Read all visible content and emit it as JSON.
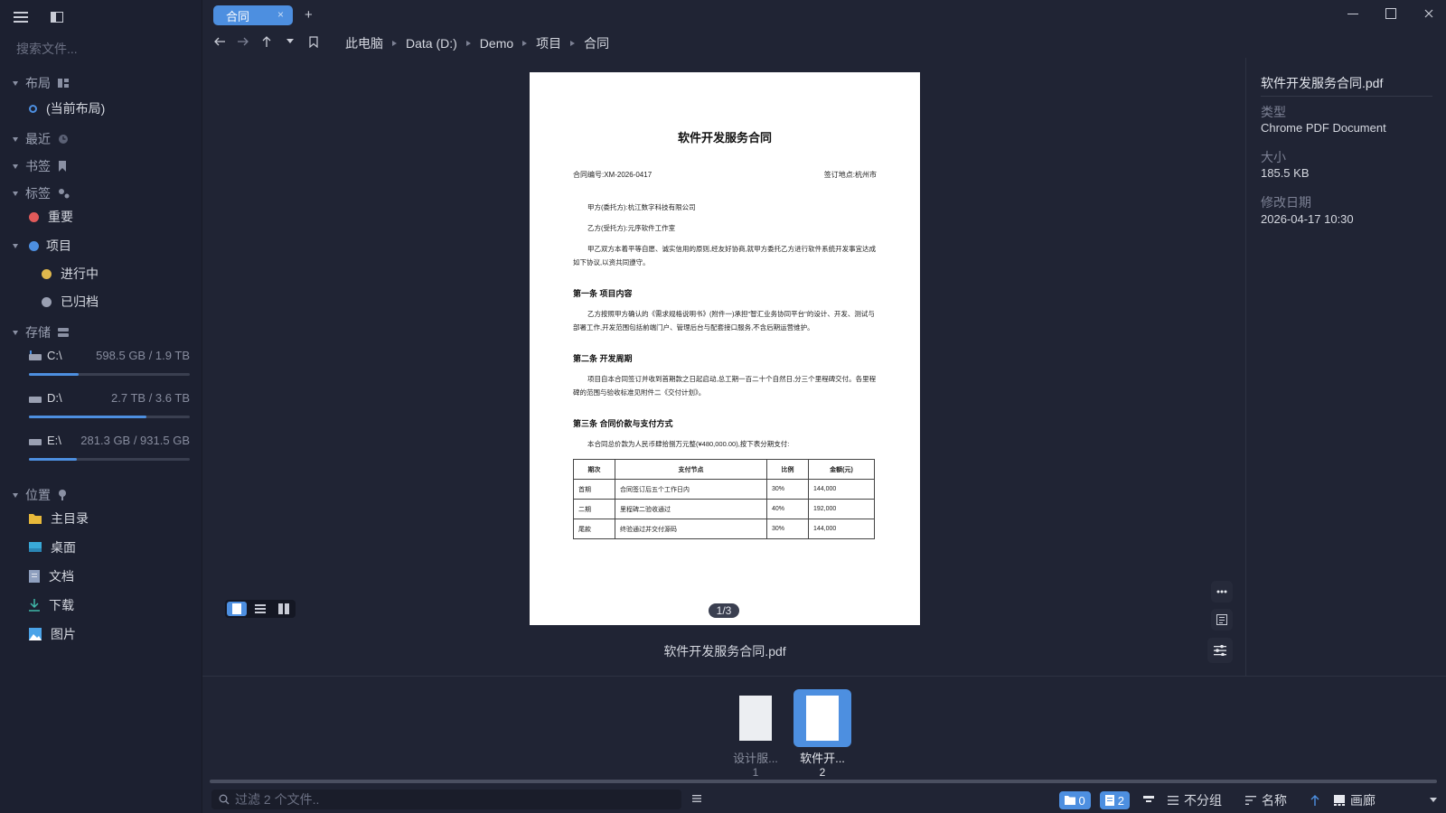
{
  "sidebar": {
    "search_placeholder": "搜索文件...",
    "sections": {
      "layout": "布局",
      "recent": "最近",
      "bookmarks": "书签",
      "tags": "标签",
      "storage": "存储",
      "locations": "位置"
    },
    "layout_current": "(当前布局)",
    "tags": [
      {
        "label": "重要",
        "color": "#e05a5a"
      },
      {
        "label": "项目",
        "color": "#4d8fe0"
      },
      {
        "label": "进行中",
        "color": "#e0b84d"
      },
      {
        "label": "已归档",
        "color": "#9aa0b2"
      }
    ],
    "drives": [
      {
        "name": "C:\\",
        "capacity": "598.5 GB / 1.9 TB",
        "used_fraction": 0.31
      },
      {
        "name": "D:\\",
        "capacity": "2.7 TB / 3.6 TB",
        "used_fraction": 0.73
      },
      {
        "name": "E:\\",
        "capacity": "281.3 GB / 931.5 GB",
        "used_fraction": 0.3
      }
    ],
    "locations": [
      {
        "label": "主目录",
        "icon": "folder-icon"
      },
      {
        "label": "桌面",
        "icon": "desktop-icon"
      },
      {
        "label": "文档",
        "icon": "document-icon"
      },
      {
        "label": "下载",
        "icon": "download-icon"
      },
      {
        "label": "图片",
        "icon": "image-icon"
      }
    ]
  },
  "tabs": [
    {
      "label": "合同",
      "close": "×"
    }
  ],
  "new_tab": "+",
  "breadcrumb": [
    "此电脑",
    "Data (D:)",
    "Demo",
    "项目",
    "合同"
  ],
  "document": {
    "title": "软件开发服务合同",
    "contract_no": "合同编号:XM-2026-0417",
    "place": "签订地点:杭州市",
    "party_a": "甲方(委托方):杭江数字科技有限公司",
    "party_b": "乙方(受托方):元序软件工作室",
    "intro": "甲乙双方本着平等自愿、诚实信用的原则,经友好协商,就甲方委托乙方进行软件系统开发事宜达成如下协议,以资共同遵守。",
    "s1_title": "第一条 项目内容",
    "s1_body": "乙方按照甲方确认的《需求规格说明书》(附件一)承担\"智汇业务协同平台\"的设计、开发、测试与部署工作,开发范围包括前端门户、管理后台与配套接口服务,不含后期运营维护。",
    "s2_title": "第二条 开发周期",
    "s2_body": "项目自本合同签订并收到首期款之日起启动,总工期一百二十个自然日,分三个里程碑交付。各里程碑的范围与验收标准见附件二《交付计划》。",
    "s3_title": "第三条 合同价款与支付方式",
    "s3_body": "本合同总价款为人民币肆拾捌万元整(¥480,000.00),按下表分期支付:",
    "table_headers": [
      "期次",
      "支付节点",
      "比例",
      "金额(元)"
    ],
    "table_rows": [
      [
        "首期",
        "合同签订后五个工作日内",
        "30%",
        "144,000"
      ],
      [
        "二期",
        "里程碑二验收通过",
        "40%",
        "192,000"
      ],
      [
        "尾款",
        "终验通过并交付源码",
        "30%",
        "144,000"
      ]
    ]
  },
  "preview": {
    "page_indicator": "1/3",
    "filename": "软件开发服务合同.pdf"
  },
  "info": {
    "filename": "软件开发服务合同.pdf",
    "type_label": "类型",
    "type_value": "Chrome PDF Document",
    "size_label": "大小",
    "size_value": "185.5 KB",
    "modified_label": "修改日期",
    "modified_value": "2026-04-17 10:30"
  },
  "strip": [
    {
      "label": "设计服...",
      "num": "1",
      "selected": false
    },
    {
      "label": "软件开...",
      "num": "2",
      "selected": true
    }
  ],
  "status": {
    "filter_placeholder": "过滤 2 个文件..",
    "folders_count": "0",
    "files_count": "2",
    "group_label": "不分组",
    "sort_label": "名称",
    "view_label": "画廊"
  },
  "colors": {
    "accent": "#4d8fe0",
    "background": "#202434",
    "sidebar": "#1c2030"
  }
}
